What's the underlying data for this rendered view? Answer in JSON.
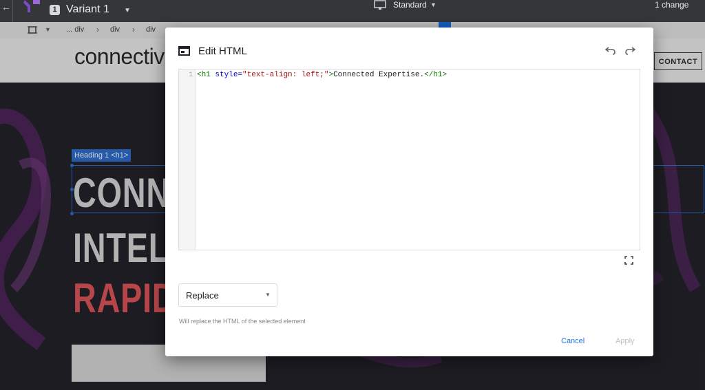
{
  "topbar": {
    "variant_number": "1",
    "variant_name": "Variant 1",
    "device": "Standard",
    "changes": "1 change"
  },
  "breadcrumbs": [
    "... div",
    "div",
    "div"
  ],
  "page": {
    "brand": "connectiv",
    "contact": "CONTACT",
    "heading_tag": "Heading 1 <h1>",
    "hero_lines": [
      "CONN",
      "INTEL",
      "RAPID"
    ]
  },
  "dialog": {
    "title": "Edit HTML",
    "code_line_number": "1",
    "code": {
      "open_tag": "<h1",
      "attr_name": " style=",
      "attr_value": "\"text-align: left;\"",
      "open_close": ">",
      "text": "Connected Expertise.",
      "close_tag": "</h1>"
    },
    "mode_select": "Replace",
    "hint": "Will replace the HTML of the selected element",
    "cancel": "Cancel",
    "apply": "Apply"
  },
  "colors": {
    "accent": "#1a73e8",
    "hero_red": "#e0565b"
  },
  "icons": [
    "back-arrow-icon",
    "optimize-logo-icon",
    "monitor-icon",
    "frame-icon",
    "html-editor-icon",
    "undo-icon",
    "redo-icon",
    "fullscreen-icon",
    "chevron-down-icon"
  ]
}
